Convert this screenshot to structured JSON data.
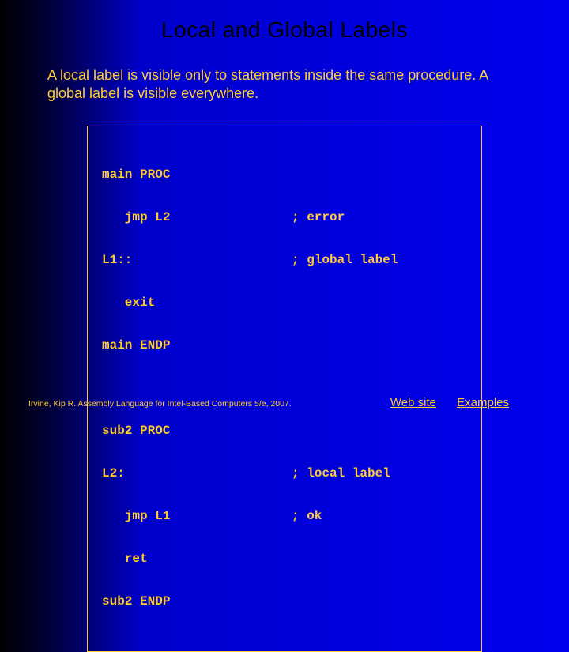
{
  "title": "Local and Global Labels",
  "body": "A local label is visible only to statements inside the same procedure. A global label is visible everywhere.",
  "code": {
    "block1": {
      "l1_left": "main PROC",
      "l2_left": "   jmp L2",
      "l2_right": "; error",
      "l3_left": "L1::",
      "l3_right": "; global label",
      "l4_left": "   exit",
      "l5_left": "main ENDP"
    },
    "block2": {
      "l1_left": "sub2 PROC",
      "l2_left": "L2:",
      "l2_right": "; local label",
      "l3_left": "   jmp L1",
      "l3_right": "; ok",
      "l4_left": "   ret",
      "l5_left": "sub2 ENDP"
    }
  },
  "citation": "Irvine, Kip R. Assembly Language for Intel-Based Computers 5/e, 2007.",
  "links": {
    "website": "Web site",
    "examples": "Examples"
  }
}
